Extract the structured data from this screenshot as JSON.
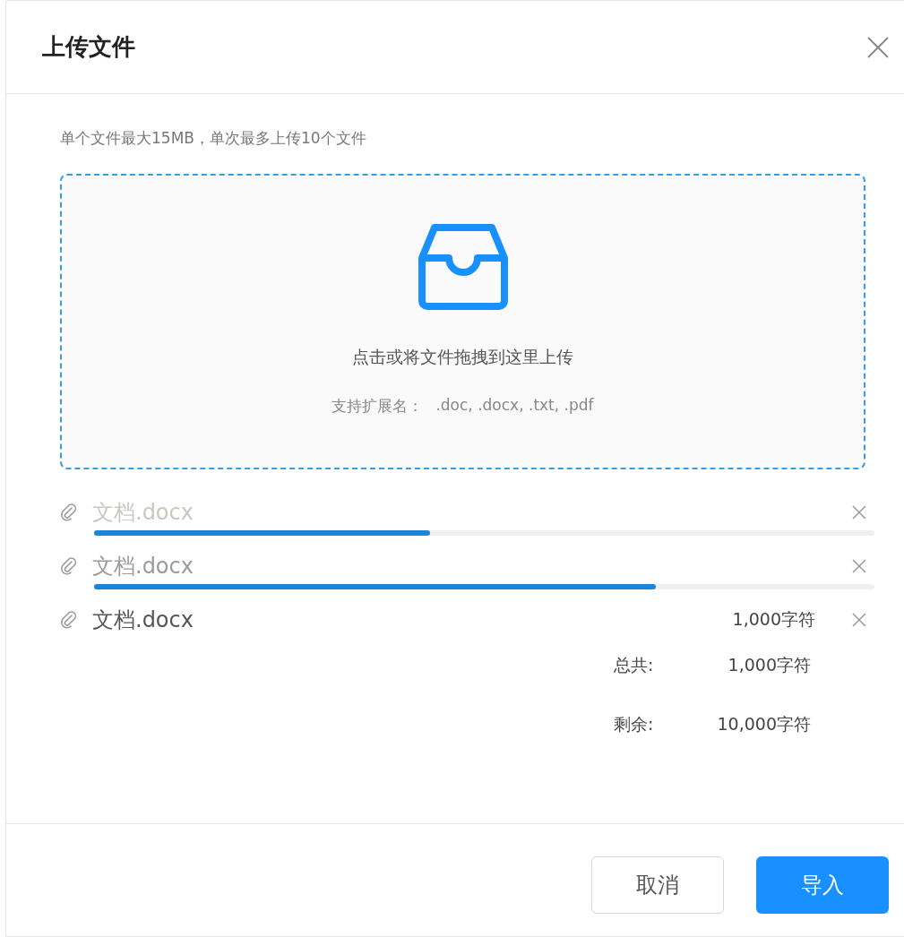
{
  "dialog": {
    "title": "上传文件"
  },
  "hint": "单个文件最大15MB，单次最多上传10个文件",
  "dropzone": {
    "text": "点击或将文件拖拽到这里上传",
    "extensions_label": "支持扩展名：",
    "extensions": ".doc, .docx, .txt, .pdf"
  },
  "files": [
    {
      "name": "文档.docx",
      "kind": "uploading",
      "level": 0.43
    },
    {
      "name": "文档.docx",
      "kind": "uploading",
      "level": 0.72
    },
    {
      "name": "文档.docx",
      "kind": "done",
      "count": "1,000字符"
    }
  ],
  "summary": [
    {
      "label": "总共:",
      "value": "1,000字符"
    },
    {
      "label": "剩余:",
      "value": "10,000字符"
    }
  ],
  "buttons": [
    {
      "label": "取消",
      "kind": "default"
    },
    {
      "label": "导入",
      "kind": "primary"
    }
  ]
}
